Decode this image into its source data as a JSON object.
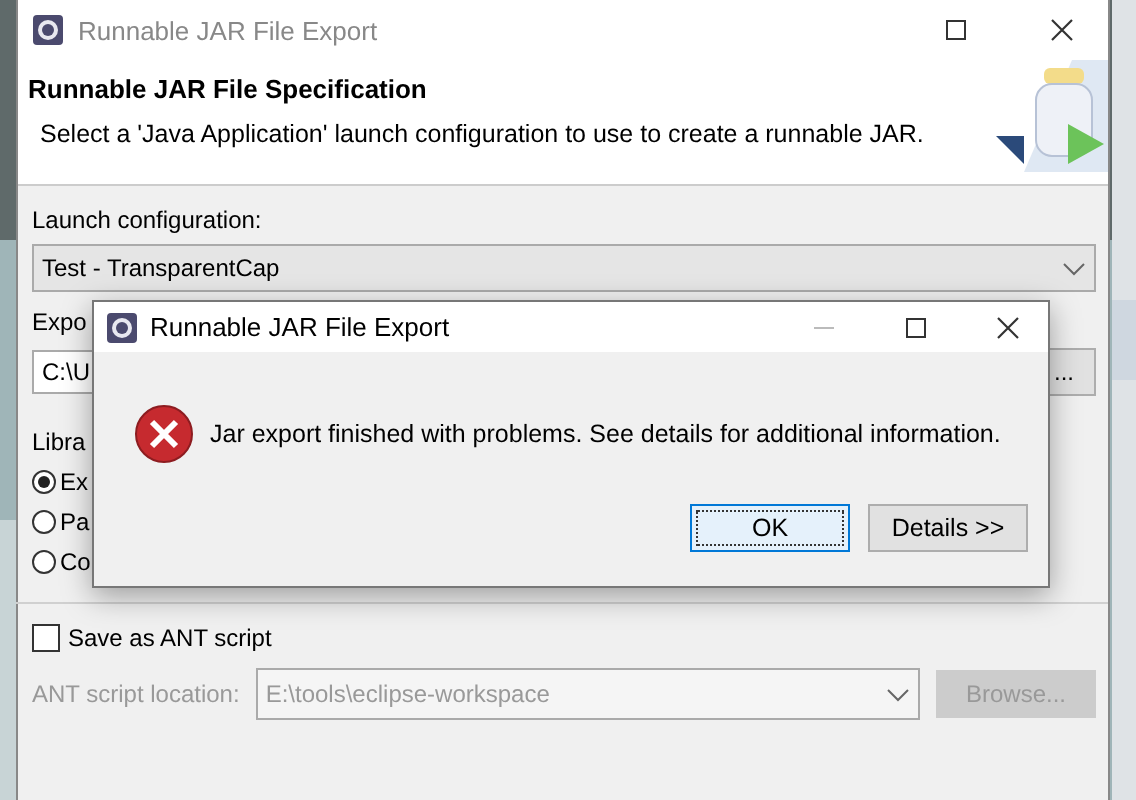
{
  "window": {
    "title": "Runnable JAR File Export"
  },
  "header": {
    "title": "Runnable JAR File Specification",
    "description": "Select a 'Java Application' launch configuration to use to create a runnable JAR."
  },
  "launch_configuration": {
    "label": "Launch configuration:",
    "value": "Test - TransparentCap"
  },
  "export_destination": {
    "label": "Expo",
    "value": "C:\\U",
    "button": "..."
  },
  "library_handling": {
    "label": "Libra",
    "options": [
      {
        "label": "Ex",
        "selected": true
      },
      {
        "label": "Pa",
        "selected": false
      },
      {
        "label": "Co",
        "selected": false
      }
    ]
  },
  "save_ant_script": {
    "label": "Save as ANT script",
    "checked": false
  },
  "ant_script_location": {
    "label": "ANT script location:",
    "value": "E:\\tools\\eclipse-workspace",
    "disabled": true,
    "button": "Browse..."
  },
  "dialog": {
    "title": "Runnable JAR File Export",
    "message": "Jar export finished with problems. See details for additional information.",
    "buttons": [
      {
        "label": "OK",
        "focused": true
      },
      {
        "label": "Details >>",
        "focused": false
      }
    ]
  }
}
